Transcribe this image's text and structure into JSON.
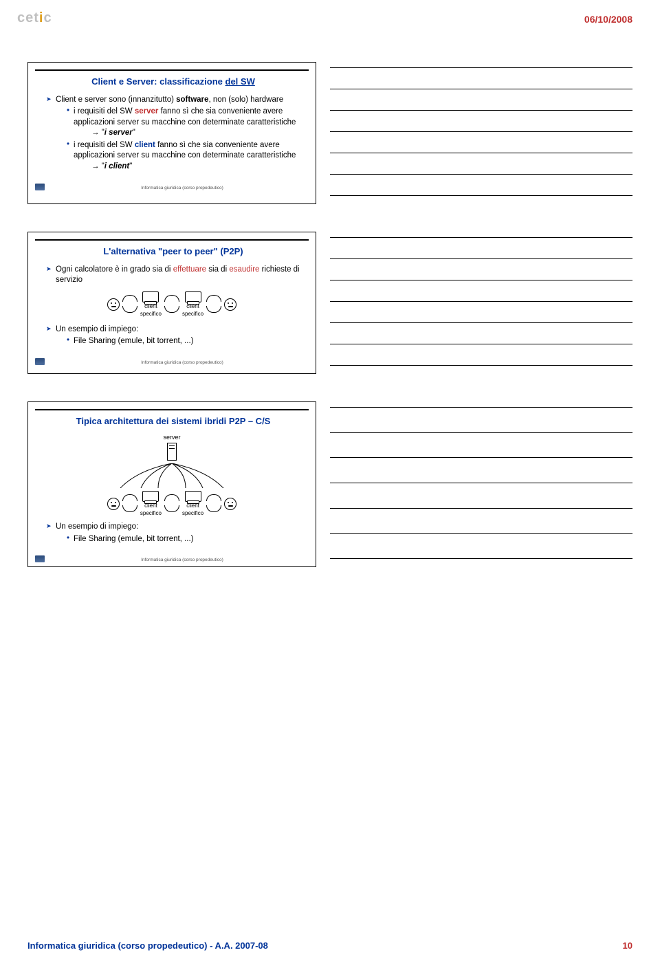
{
  "header": {
    "date": "06/10/2008",
    "logo_text": "cet",
    "logo_accent": "i",
    "logo_text2": "c"
  },
  "footer": {
    "left": "Informatica giuridica (corso propedeutico) - A.A. 2007-08",
    "right": "10"
  },
  "slide_footer": "Informatica giuridica (corso propedeutico)",
  "slides": [
    {
      "title": "Client e Server: classificazione del SW",
      "title_markup": "Client e Server: classificazione __del SW__",
      "bullets_main": [
        {
          "text": "Client e server sono (innanzitutto) **software**, non (solo) hardware",
          "subs": [
            {
              "text": "i requisiti del SW **server** fanno sì che sia conveniente avere applicazioni server su macchine con determinate caratteristiche",
              "server_word": "server",
              "arrow": "→ \"**i server**\""
            },
            {
              "text": "i requisiti del SW **client** fanno sì che sia conveniente avere applicazioni server su macchine con determinate caratteristiche",
              "client_word": "client",
              "arrow": "→ \"**i client**\""
            }
          ]
        }
      ]
    },
    {
      "title": "L'alternativa \"peer to peer\" (P2P)",
      "bullet1": "Ogni calcolatore è in grado sia di effettuare sia di esaudire richieste di servizio",
      "bullet1_red1": "effettuare",
      "bullet1_red2": "esaudire",
      "diagram_labels": {
        "client": "client",
        "specifico": "specifico"
      },
      "bullet2": "Un esempio di impiego:",
      "sub2": "File Sharing (emule, bit torrent, ...)"
    },
    {
      "title": "Tipica architettura dei sistemi ibridi P2P – C/S",
      "server_label": "server",
      "diagram_labels": {
        "client": "client",
        "specifico": "specifico"
      },
      "bullet": "Un esempio di impiego:",
      "sub": "File Sharing (emule, bit torrent, ...)"
    }
  ]
}
